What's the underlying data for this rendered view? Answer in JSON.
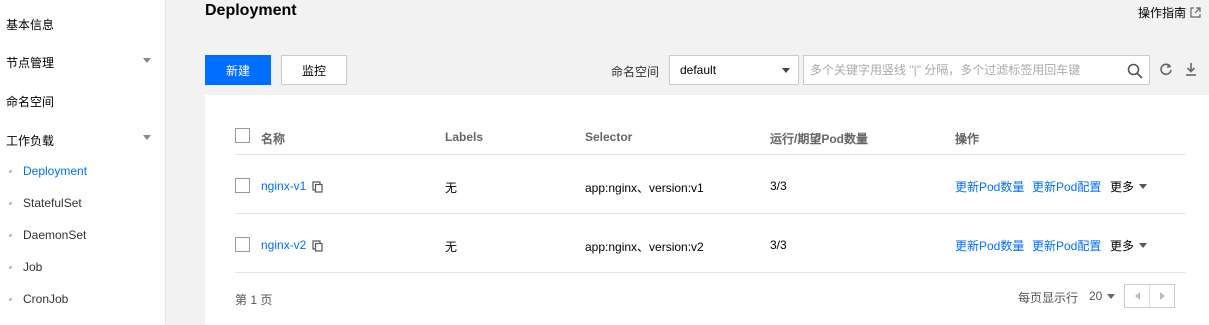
{
  "sidebar": {
    "items": [
      {
        "label": "基本信息"
      },
      {
        "label": "节点管理"
      },
      {
        "label": "命名空间"
      },
      {
        "label": "工作负载"
      }
    ],
    "workload_sub": [
      {
        "label": "Deployment"
      },
      {
        "label": "StatefulSet"
      },
      {
        "label": "DaemonSet"
      },
      {
        "label": "Job"
      },
      {
        "label": "CronJob"
      }
    ]
  },
  "header": {
    "title": "Deployment",
    "guide_label": "操作指南"
  },
  "toolbar": {
    "create_label": "新建",
    "monitor_label": "监控",
    "namespace_label": "命名空间",
    "namespace_value": "default",
    "search_placeholder": "多个关键字用竖线 \"|\" 分隔，多个过滤标签用回车键"
  },
  "table": {
    "columns": [
      "名称",
      "Labels",
      "Selector",
      "运行/期望Pod数量",
      "操作"
    ],
    "rows": [
      {
        "name": "nginx-v1",
        "labels": "无",
        "selector": "app:nginx、version:v1",
        "pods": "3/3",
        "action1": "更新Pod数量",
        "action2": "更新Pod配置",
        "more": "更多"
      },
      {
        "name": "nginx-v2",
        "labels": "无",
        "selector": "app:nginx、version:v2",
        "pods": "3/3",
        "action1": "更新Pod数量",
        "action2": "更新Pod配置",
        "more": "更多"
      }
    ]
  },
  "footer": {
    "page_text": "第 1 页",
    "per_page_label": "每页显示行",
    "per_page_value": "20"
  },
  "colors": {
    "accent": "#006eff"
  }
}
